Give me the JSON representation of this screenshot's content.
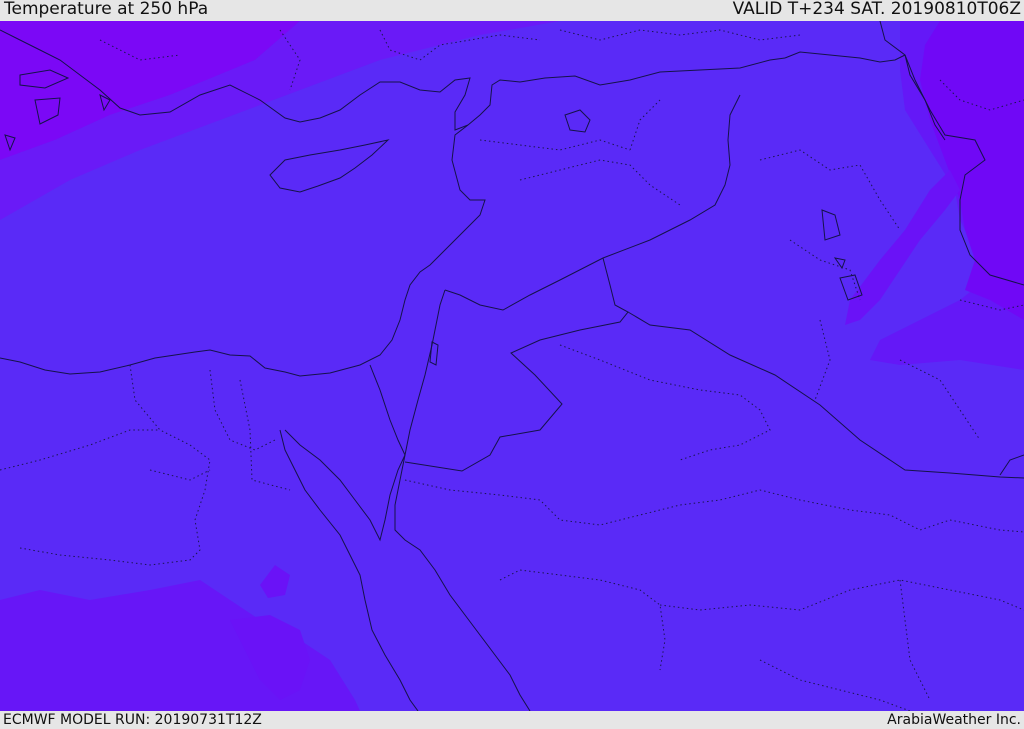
{
  "header": {
    "title": "Temperature at 250 hPa",
    "valid": "VALID T+234 SAT. 20190810T06Z"
  },
  "footer": {
    "model_run": "ECMWF MODEL RUN: 20190731T12Z",
    "credit": "ArabiaWeather Inc."
  },
  "map": {
    "colors": {
      "field_main": "#5a2af7",
      "field_warm": "#7a08f7",
      "field_mid": "#6a1cf7",
      "lines": "#15124a"
    }
  }
}
